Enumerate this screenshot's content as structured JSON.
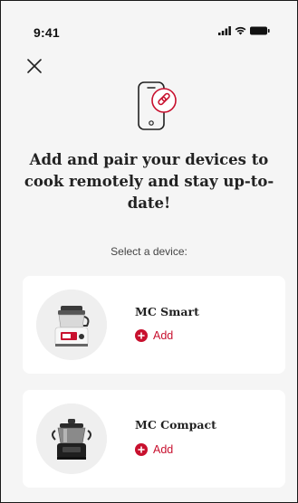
{
  "status_bar": {
    "time": "9:41"
  },
  "header": {
    "close_icon": "close-icon"
  },
  "hero": {
    "icon": "phone-link-icon",
    "headline": "Add and pair your devices to cook remotely and stay up-to-date!"
  },
  "select_label": "Select a device:",
  "devices": [
    {
      "name": "MC Smart",
      "add_label": "Add",
      "image": "mc-smart-device"
    },
    {
      "name": "MC Compact",
      "add_label": "Add",
      "image": "mc-compact-device"
    }
  ],
  "colors": {
    "accent": "#c8102e",
    "background": "#f5f5f5",
    "card": "#ffffff"
  }
}
